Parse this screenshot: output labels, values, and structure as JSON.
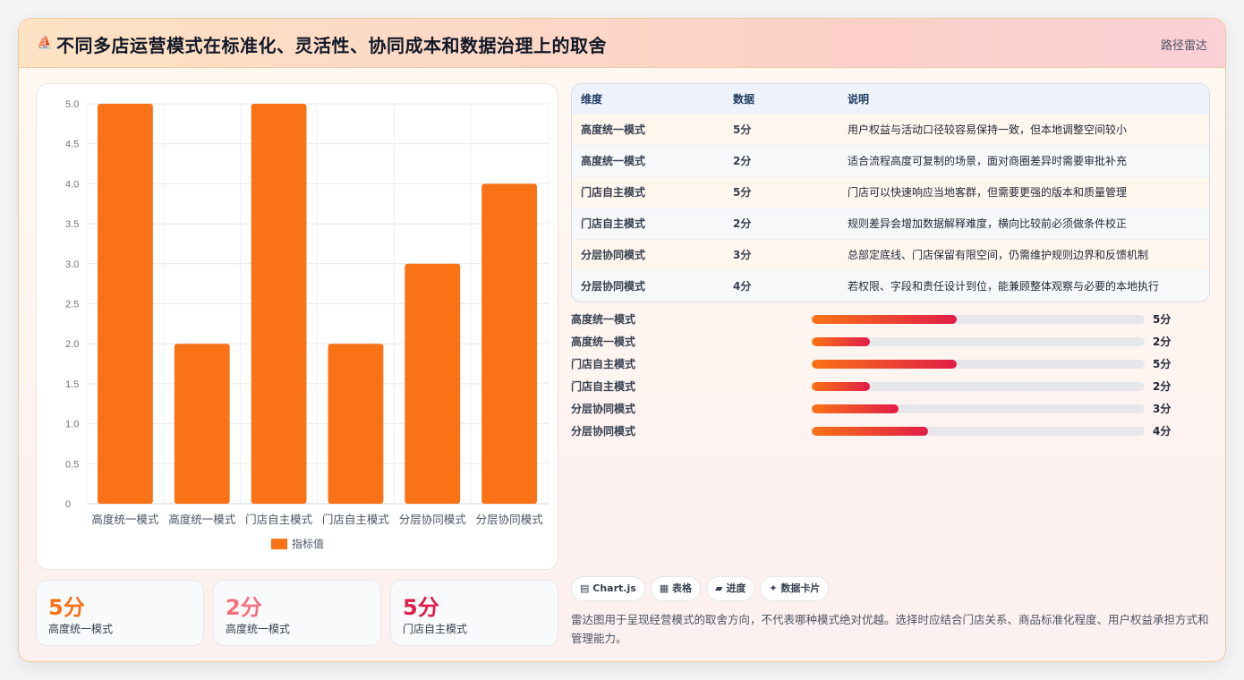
{
  "header": {
    "icon": "ship-icon",
    "title": "不同多店运营模式在标准化、灵活性、协同成本和数据治理上的取舍",
    "tag": "路径雷达"
  },
  "chart_data": {
    "type": "bar",
    "categories": [
      "高度统一模式",
      "高度统一模式",
      "门店自主模式",
      "门店自主模式",
      "分层协同模式",
      "分层协同模式"
    ],
    "series": [
      {
        "name": "指标值",
        "values": [
          5,
          2,
          5,
          2,
          3,
          4
        ],
        "color": "#f97316"
      }
    ],
    "ylim": [
      0,
      5
    ],
    "yticks": [
      "5.0",
      "4.5",
      "4.0",
      "3.5",
      "3.0",
      "2.5",
      "2.0",
      "1.5",
      "1.0",
      "0.5",
      "0"
    ],
    "grid": true,
    "legend": "bottom"
  },
  "stats": [
    {
      "value": "5分",
      "label": "高度统一模式",
      "color": "#f97316"
    },
    {
      "value": "2分",
      "label": "高度统一模式",
      "color": "#f4707f"
    },
    {
      "value": "5分",
      "label": "门店自主模式",
      "color": "#e11d48"
    }
  ],
  "table": {
    "headers": [
      "维度",
      "数据",
      "说明"
    ],
    "rows": [
      [
        "高度统一模式",
        "5分",
        "用户权益与活动口径较容易保持一致，但本地调整空间较小"
      ],
      [
        "高度统一模式",
        "2分",
        "适合流程高度可复制的场景，面对商圈差异时需要审批补充"
      ],
      [
        "门店自主模式",
        "5分",
        "门店可以快速响应当地客群，但需要更强的版本和质量管理"
      ],
      [
        "门店自主模式",
        "2分",
        "规则差异会增加数据解释难度，横向比较前必须做条件校正"
      ],
      [
        "分层协同模式",
        "3分",
        "总部定底线、门店保留有限空间，仍需维护规则边界和反馈机制"
      ],
      [
        "分层协同模式",
        "4分",
        "若权限、字段和责任设计到位，能兼顾整体观察与必要的本地执行"
      ]
    ]
  },
  "progress": [
    {
      "label": "高度统一模式",
      "value": "5分",
      "fraction": 0.435
    },
    {
      "label": "高度统一模式",
      "value": "2分",
      "fraction": 0.175
    },
    {
      "label": "门店自主模式",
      "value": "5分",
      "fraction": 0.435
    },
    {
      "label": "门店自主模式",
      "value": "2分",
      "fraction": 0.175
    },
    {
      "label": "分层协同模式",
      "value": "3分",
      "fraction": 0.26
    },
    {
      "label": "分层协同模式",
      "value": "4分",
      "fraction": 0.35
    }
  ],
  "chips": [
    {
      "icon": "chart-icon",
      "glyph": "▤",
      "label": "Chart.js"
    },
    {
      "icon": "table-icon",
      "glyph": "▦",
      "label": "表格"
    },
    {
      "icon": "progress-icon",
      "glyph": "▰",
      "label": "进度"
    },
    {
      "icon": "sparkle-icon",
      "glyph": "✦",
      "label": "数据卡片"
    }
  ],
  "note": "雷达图用于呈现经营模式的取舍方向，不代表哪种模式绝对优越。选择时应结合门店关系、商品标准化程度、用户权益承担方式和管理能力。"
}
